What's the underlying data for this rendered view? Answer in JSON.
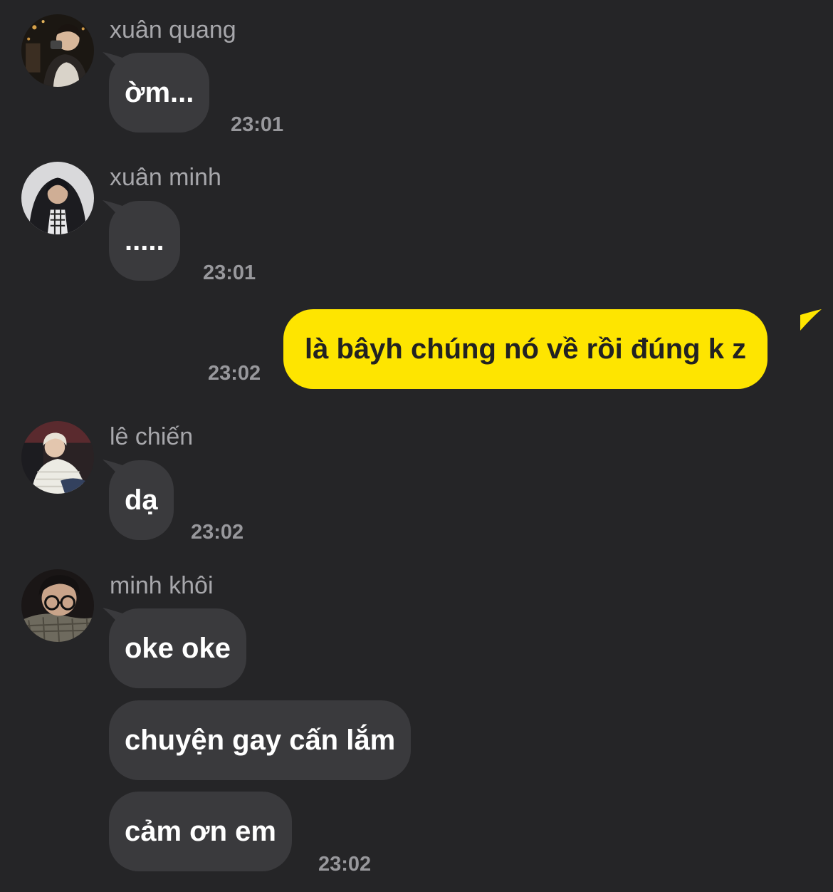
{
  "messages": [
    {
      "sender": "xuân quang",
      "text": "ờm...",
      "time": "23:01"
    },
    {
      "sender": "xuân minh",
      "text": ".....",
      "time": "23:01"
    },
    {
      "text": "là bâyh chúng nó về rồi đúng k z",
      "time": "23:02",
      "outgoing": true
    },
    {
      "sender": "lê chiến",
      "text": "dạ",
      "time": "23:02"
    },
    {
      "sender": "minh khôi",
      "lines": [
        "oke oke",
        "chuyện gay cấn lắm",
        "cảm ơn em"
      ],
      "time": "23:02"
    }
  ],
  "colors": {
    "background": "#252527",
    "incoming_bubble": "#3a3a3d",
    "outgoing_bubble": "#fee500",
    "sender_text": "#a7a7ab",
    "time_text": "#98989c"
  },
  "icons": [
    "avatar-xuan-quang",
    "avatar-xuan-minh",
    "avatar-le-chien",
    "avatar-minh-khoi"
  ]
}
